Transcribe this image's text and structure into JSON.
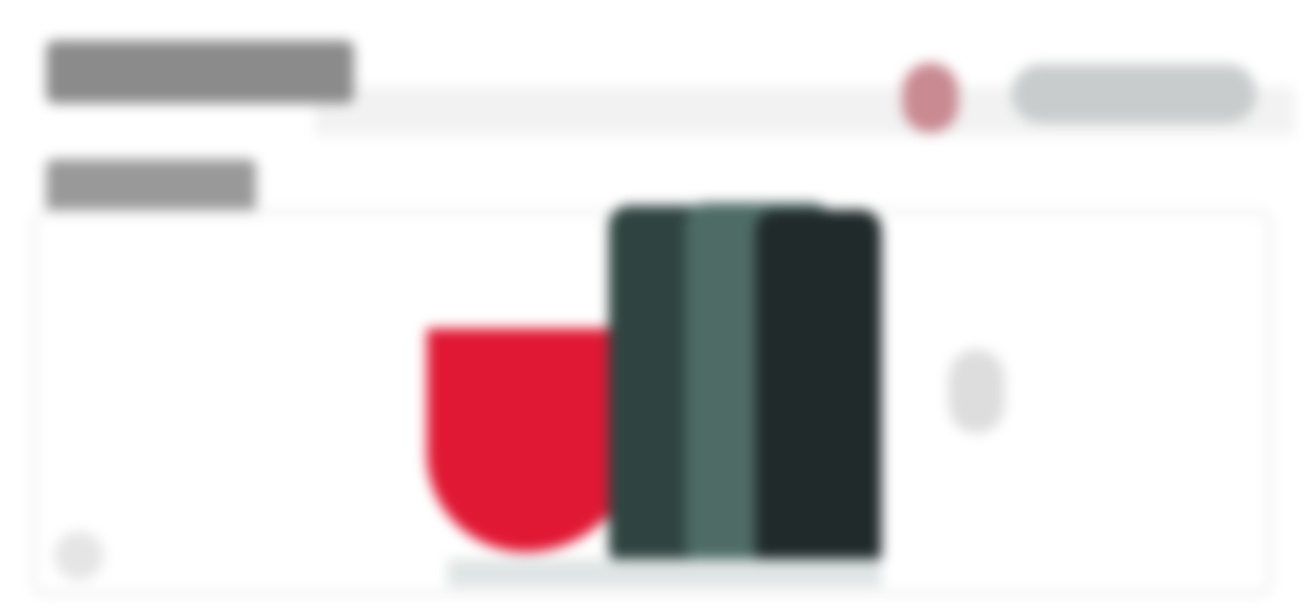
{
  "header": {
    "title": "",
    "subtitle": "",
    "action_label": ""
  },
  "hero": {
    "alt": ""
  },
  "carousel": {
    "prev_label": "",
    "next_label": ""
  },
  "colors": {
    "accent_red": "#e01834",
    "phone_dark": "#2f4440",
    "phone_mid": "#4e6b65",
    "phone_darkest": "#202a2a",
    "background": "#ffffff"
  }
}
